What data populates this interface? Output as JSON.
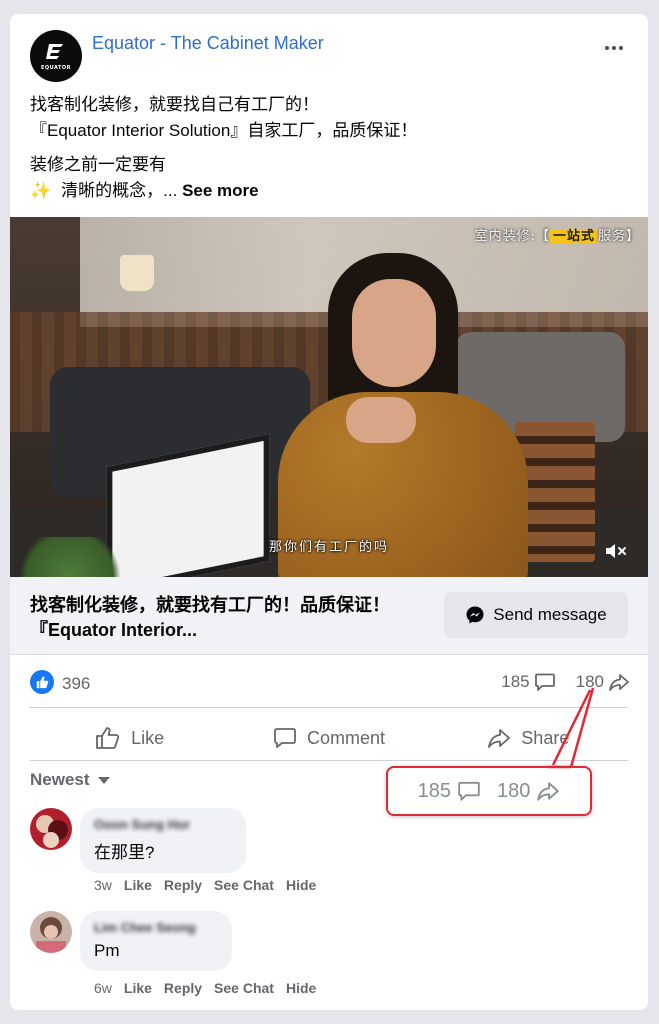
{
  "post": {
    "page_name": "Equator - The Cabinet Maker",
    "logo_text": "EQUATOR",
    "text_line1": "找客制化装修，就要找自己有工厂的！",
    "text_line2": "『Equator Interior Solution』自家工厂，品质保证！",
    "text_line3": "装修之前一定要有",
    "text_line4_emoji": "✨",
    "text_line4": "清晰的概念，...",
    "see_more": "See more"
  },
  "video": {
    "caption_prefix": "室内装修:【",
    "caption_highlight": "一站式",
    "caption_suffix": "服务】",
    "subtitle": "那你们有工厂的吗",
    "mute_icon": "speaker-muted-icon"
  },
  "link_bar": {
    "title": "找客制化装修，就要找有工厂的！品质保证！『Equator Interior...",
    "send_message_label": "Send message"
  },
  "stats": {
    "likes": "396",
    "comments": "185",
    "shares": "180"
  },
  "actions": {
    "like": "Like",
    "comment": "Comment",
    "share": "Share"
  },
  "sort": {
    "label": "Newest"
  },
  "callout": {
    "comments": "185",
    "shares": "180",
    "color": "#e02a36"
  },
  "comments": [
    {
      "author": "Ooon Sung Hor",
      "text": "在那里?",
      "time": "3w",
      "like": "Like",
      "reply": "Reply",
      "see_chat": "See Chat",
      "hide": "Hide"
    },
    {
      "author": "Lim Chee Seong",
      "text": "Pm",
      "time": "6w",
      "like": "Like",
      "reply": "Reply",
      "see_chat": "See Chat",
      "hide": "Hide"
    }
  ],
  "colors": {
    "page_name": "#2f6ec9",
    "like_blue": "#1877f2",
    "muted_text": "#65676b",
    "link_bar_bg": "#f0f2f5"
  }
}
